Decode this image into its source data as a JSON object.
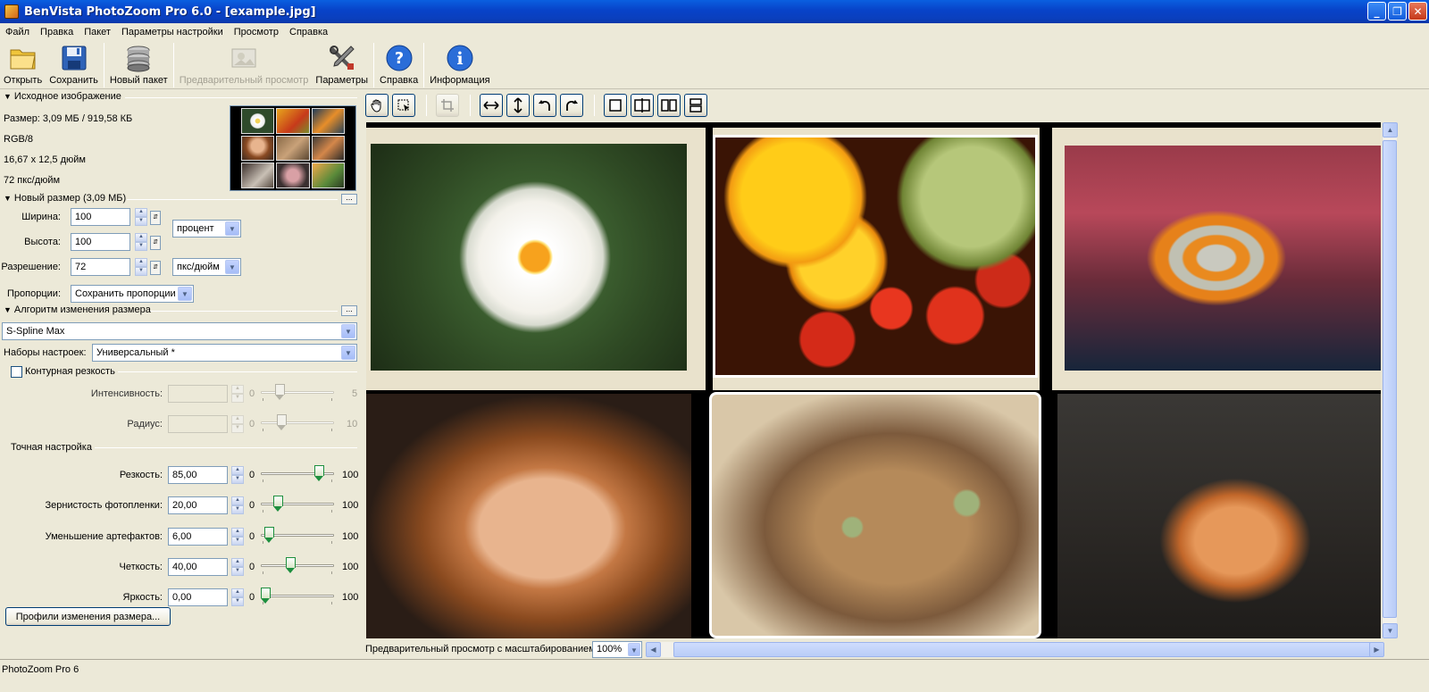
{
  "window": {
    "title": "BenVista PhotoZoom Pro 6.0 - [example.jpg]"
  },
  "menu": [
    "Файл",
    "Правка",
    "Пакет",
    "Параметры настройки",
    "Просмотр",
    "Справка"
  ],
  "toolbar": {
    "open": "Открыть",
    "save": "Сохранить",
    "new_batch": "Новый пакет",
    "preview": "Предварительный просмотр",
    "settings": "Параметры",
    "help": "Справка",
    "info": "Информация"
  },
  "source": {
    "heading": "Исходное изображение",
    "size": "Размер: 3,09 МБ / 919,58 КБ",
    "mode": "RGB/8",
    "dimensions": "16,67 x 12,5 дюйм",
    "resolution": "72 пкс/дюйм"
  },
  "new_size": {
    "heading": "Новый размер (3,09 МБ)",
    "width_label": "Ширина:",
    "width_value": "100",
    "height_label": "Высота:",
    "height_value": "100",
    "unit": "процент",
    "resolution_label": "Разрешение:",
    "resolution_value": "72",
    "resolution_unit": "пкс/дюйм",
    "proportions_label": "Пропорции:",
    "proportions_value": "Сохранить пропорции"
  },
  "algorithm": {
    "heading": "Алгоритм изменения размера",
    "method": "S-Spline Max",
    "presets_label": "Наборы настроек:",
    "presets_value": "Универсальный *"
  },
  "unsharp": {
    "label": "Контурная резкость",
    "checked": false,
    "intensity_label": "Интенсивность:",
    "intensity_min": "0",
    "intensity_max": "5",
    "radius_label": "Радиус:",
    "radius_min": "0",
    "radius_max": "10"
  },
  "fine_tuning": {
    "heading": "Точная настройка",
    "rows": [
      {
        "label": "Резкость:",
        "value": "85,00",
        "min": "0",
        "max": "100",
        "level": 0.85
      },
      {
        "label": "Зернистость фотопленки:",
        "value": "20,00",
        "min": "0",
        "max": "100",
        "level": 0.2
      },
      {
        "label": "Уменьшение артефактов:",
        "value": "6,00",
        "min": "0",
        "max": "100",
        "level": 0.06
      },
      {
        "label": "Четкость:",
        "value": "40,00",
        "min": "0",
        "max": "100",
        "level": 0.4
      },
      {
        "label": "Яркость:",
        "value": "0,00",
        "min": "0",
        "max": "100",
        "level": 0.0
      }
    ]
  },
  "profiles_button": "Профили изменения размера...",
  "zoom": {
    "label": "Предварительный просмотр с масштабированием:",
    "value": "100%"
  },
  "status": "PhotoZoom Pro 6"
}
